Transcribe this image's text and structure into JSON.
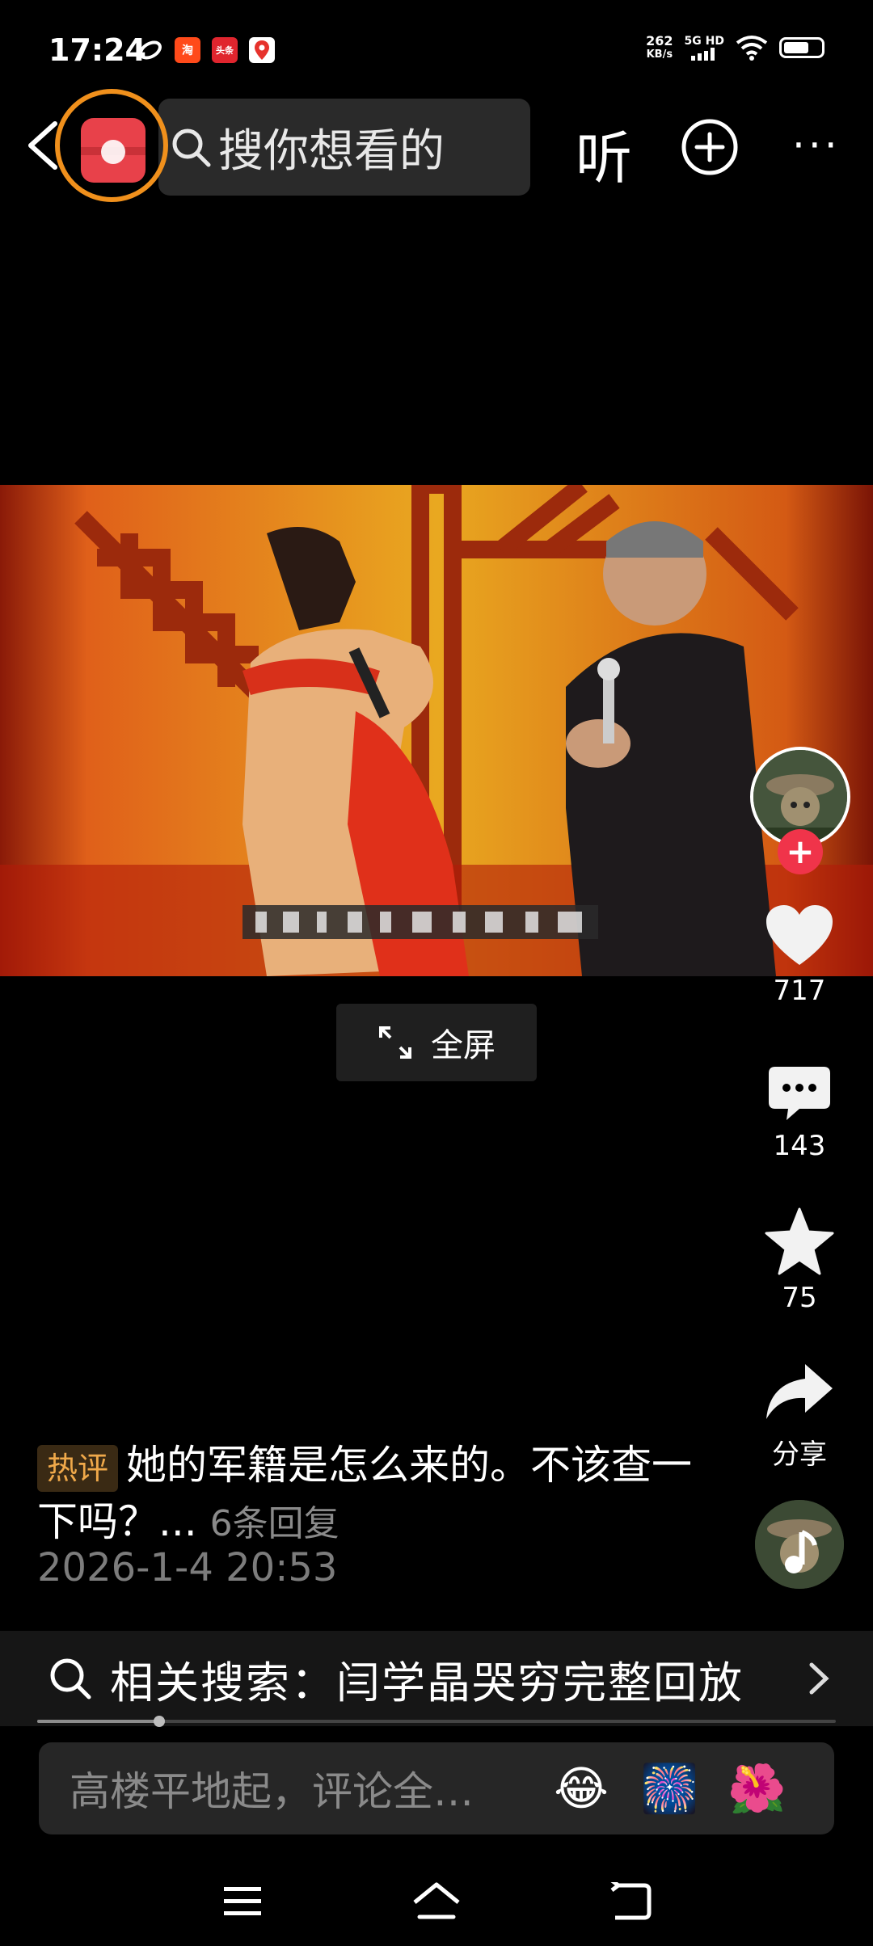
{
  "status_bar": {
    "time": "17:24",
    "app_icons": [
      "淘",
      "头条"
    ],
    "net_speed_value": "262",
    "net_speed_unit": "KB/s",
    "network": "5G HD"
  },
  "top_bar": {
    "search_placeholder": "搜你想看的",
    "listen_label": "听"
  },
  "video": {
    "fullscreen_label": "全屏"
  },
  "actions": {
    "like_count": "717",
    "comment_count": "143",
    "favorite_count": "75",
    "share_label": "分享"
  },
  "comment": {
    "tag": "热评",
    "text": "她的军籍是怎么来的。不该查一下吗？...",
    "replies": "6条回复",
    "time": "2026-1-4 20:53"
  },
  "related_search": {
    "label": "相关搜索：闫学晶哭穷完整回放"
  },
  "comment_input": {
    "placeholder": "高楼平地起，评论全…"
  },
  "colors": {
    "accent_red": "#f0344a",
    "hot_tag": "#f0a94a",
    "ring_orange": "#f0901c"
  }
}
